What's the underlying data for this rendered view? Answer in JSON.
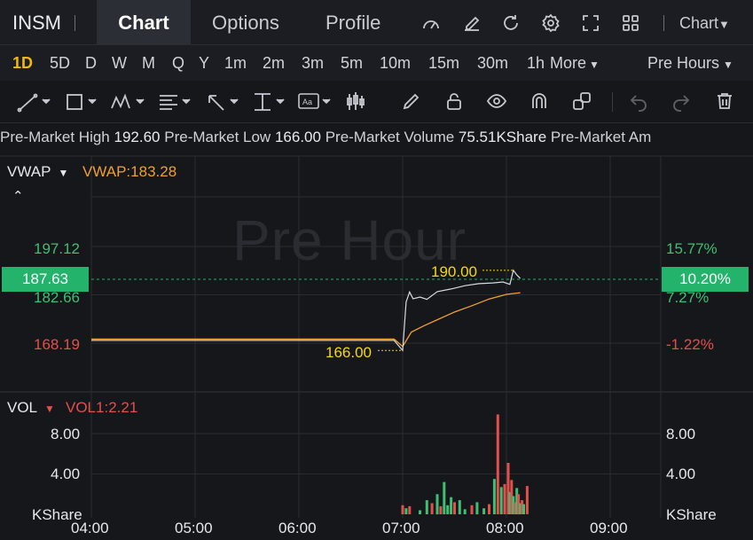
{
  "header": {
    "symbol": "INSM",
    "tabs": [
      {
        "label": "Chart",
        "active": true
      },
      {
        "label": "Options",
        "active": false
      },
      {
        "label": "Profile",
        "active": false
      }
    ],
    "chart_menu_label": "Chart"
  },
  "periods": {
    "items": [
      "1D",
      "5D",
      "D",
      "W",
      "M",
      "Q",
      "Y",
      "1m",
      "2m",
      "3m",
      "5m",
      "10m",
      "15m",
      "30m",
      "1h"
    ],
    "active": "1D",
    "more_label": "More",
    "session_label": "Pre Hours"
  },
  "info_strip": {
    "items": [
      {
        "label": "Pre-Market High",
        "value": "192.60"
      },
      {
        "label": "Pre-Market Low",
        "value": "166.00"
      },
      {
        "label": "Pre-Market Volume",
        "value": "75.51KShare"
      },
      {
        "label": "Pre-Market Am",
        "value": ""
      }
    ]
  },
  "price_panel": {
    "indicator_label": "VWAP",
    "indicator_value": "VWAP:183.28",
    "watermark": "Pre Hour",
    "left_ticks": [
      {
        "text": "197.12",
        "color": "green"
      },
      {
        "text": "182.66",
        "color": "green"
      },
      {
        "text": "168.19",
        "color": "red"
      }
    ],
    "right_ticks": [
      {
        "text": "15.77%",
        "color": "green"
      },
      {
        "text": "7.27%",
        "color": "green"
      },
      {
        "text": "-1.22%",
        "color": "red"
      }
    ],
    "current_price": "187.63",
    "current_pct": "10.20%",
    "high_marker": "190.00",
    "low_marker": "166.00"
  },
  "volume_panel": {
    "indicator_label": "VOL",
    "indicator_value": "VOL1:2.21",
    "left_ticks": [
      "8.00",
      "4.00",
      "KShare"
    ],
    "right_ticks": [
      "8.00",
      "4.00",
      "KShare"
    ]
  },
  "x_axis": [
    "04:00",
    "05:00",
    "06:00",
    "07:00",
    "08:00",
    "09:00"
  ],
  "colors": {
    "up": "#3fbf73",
    "down": "#e2504c",
    "accent": "#f0b90b",
    "vwap": "#f0a030",
    "price_line": "#d8dade",
    "price_box": "#23b36b"
  },
  "chart_data": {
    "type": "line",
    "x_time_range": [
      "04:00",
      "09:00"
    ],
    "y_range": [
      164,
      200
    ],
    "price_series": [
      {
        "t": "04:00",
        "v": 169.0
      },
      {
        "t": "06:55",
        "v": 169.0
      },
      {
        "t": "07:00",
        "v": 166.0
      },
      {
        "t": "07:02",
        "v": 180.5
      },
      {
        "t": "07:04",
        "v": 183.5
      },
      {
        "t": "07:06",
        "v": 181.5
      },
      {
        "t": "07:10",
        "v": 182.0
      },
      {
        "t": "07:14",
        "v": 181.3
      },
      {
        "t": "07:20",
        "v": 183.6
      },
      {
        "t": "07:28",
        "v": 184.4
      },
      {
        "t": "07:36",
        "v": 185.4
      },
      {
        "t": "07:44",
        "v": 186.0
      },
      {
        "t": "07:52",
        "v": 186.2
      },
      {
        "t": "07:58",
        "v": 186.5
      },
      {
        "t": "08:02",
        "v": 185.8
      },
      {
        "t": "08:04",
        "v": 190.0
      },
      {
        "t": "08:06",
        "v": 188.6
      },
      {
        "t": "08:08",
        "v": 187.6
      }
    ],
    "vwap_series": [
      {
        "t": "04:00",
        "v": 169.4
      },
      {
        "t": "06:55",
        "v": 169.4
      },
      {
        "t": "07:00",
        "v": 167.2
      },
      {
        "t": "07:05",
        "v": 171.5
      },
      {
        "t": "07:12",
        "v": 173.3
      },
      {
        "t": "07:20",
        "v": 175.2
      },
      {
        "t": "07:30",
        "v": 177.5
      },
      {
        "t": "07:40",
        "v": 179.4
      },
      {
        "t": "07:50",
        "v": 181.4
      },
      {
        "t": "08:00",
        "v": 182.8
      },
      {
        "t": "08:08",
        "v": 183.3
      }
    ],
    "volume_range": [
      0,
      10
    ],
    "volume_bars": [
      {
        "t": "07:00",
        "v": 0.9,
        "dir": "down"
      },
      {
        "t": "07:02",
        "v": 0.6,
        "dir": "up"
      },
      {
        "t": "07:04",
        "v": 0.8,
        "dir": "down"
      },
      {
        "t": "07:10",
        "v": 0.4,
        "dir": "up"
      },
      {
        "t": "07:14",
        "v": 1.4,
        "dir": "up"
      },
      {
        "t": "07:17",
        "v": 1.1,
        "dir": "down"
      },
      {
        "t": "07:20",
        "v": 2.0,
        "dir": "up"
      },
      {
        "t": "07:22",
        "v": 0.8,
        "dir": "down"
      },
      {
        "t": "07:24",
        "v": 3.2,
        "dir": "up"
      },
      {
        "t": "07:26",
        "v": 0.9,
        "dir": "up"
      },
      {
        "t": "07:28",
        "v": 1.7,
        "dir": "up"
      },
      {
        "t": "07:30",
        "v": 1.2,
        "dir": "down"
      },
      {
        "t": "07:33",
        "v": 1.4,
        "dir": "up"
      },
      {
        "t": "07:36",
        "v": 0.5,
        "dir": "up"
      },
      {
        "t": "07:40",
        "v": 0.9,
        "dir": "down"
      },
      {
        "t": "07:43",
        "v": 1.2,
        "dir": "up"
      },
      {
        "t": "07:47",
        "v": 0.6,
        "dir": "up"
      },
      {
        "t": "07:50",
        "v": 1.0,
        "dir": "down"
      },
      {
        "t": "07:53",
        "v": 3.5,
        "dir": "up"
      },
      {
        "t": "07:55",
        "v": 9.9,
        "dir": "down"
      },
      {
        "t": "07:57",
        "v": 2.7,
        "dir": "up"
      },
      {
        "t": "07:59",
        "v": 3.0,
        "dir": "down"
      },
      {
        "t": "08:01",
        "v": 5.1,
        "dir": "down"
      },
      {
        "t": "08:02",
        "v": 2.2,
        "dir": "up"
      },
      {
        "t": "08:03",
        "v": 3.4,
        "dir": "down"
      },
      {
        "t": "08:04",
        "v": 1.8,
        "dir": "up"
      },
      {
        "t": "08:05",
        "v": 1.2,
        "dir": "down"
      },
      {
        "t": "08:06",
        "v": 2.6,
        "dir": "up"
      },
      {
        "t": "08:07",
        "v": 2.0,
        "dir": "down"
      },
      {
        "t": "08:08",
        "v": 1.1,
        "dir": "up"
      },
      {
        "t": "08:09",
        "v": 1.4,
        "dir": "down"
      },
      {
        "t": "08:10",
        "v": 1.0,
        "dir": "up"
      },
      {
        "t": "08:12",
        "v": 2.8,
        "dir": "down"
      }
    ]
  }
}
